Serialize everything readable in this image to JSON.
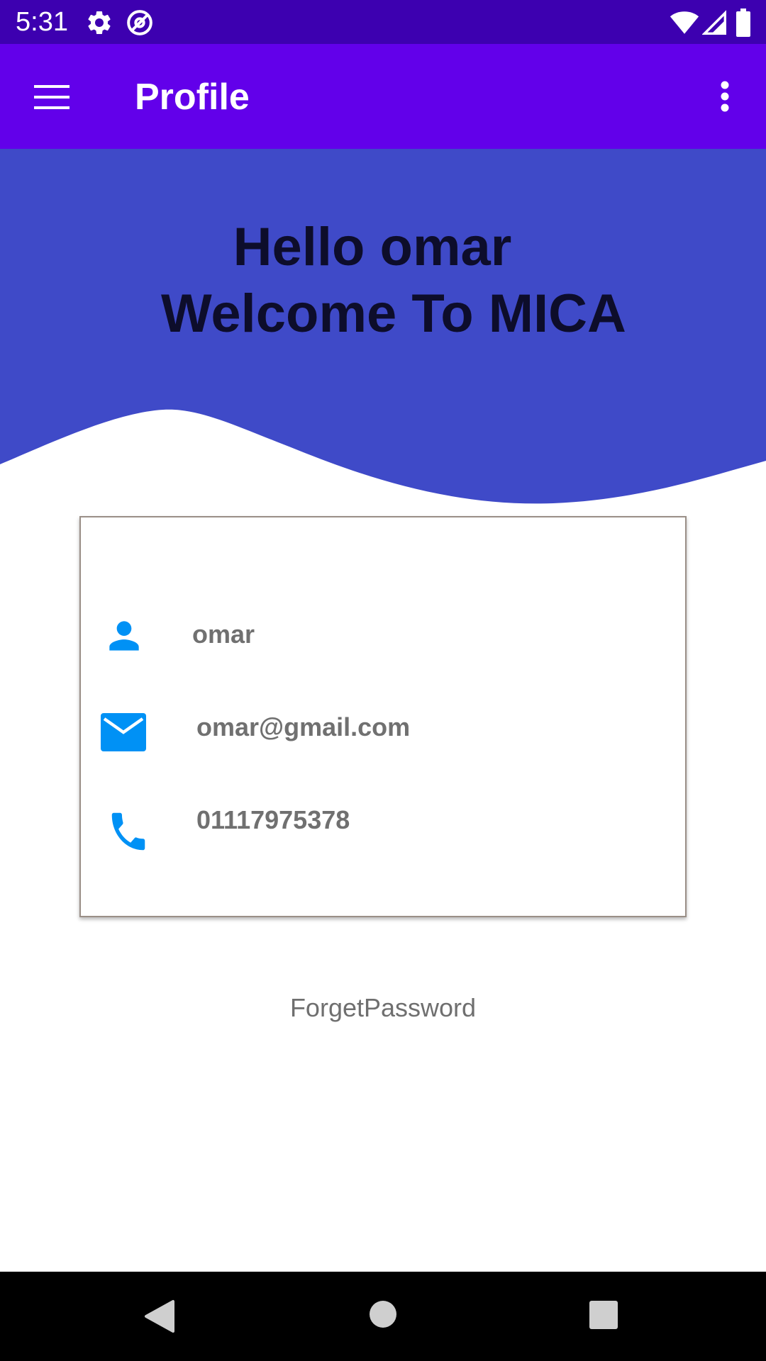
{
  "status_bar": {
    "time": "5:31",
    "icons": [
      "gear-icon",
      "at-sign-icon",
      "wifi-icon",
      "signal-icon",
      "battery-icon"
    ]
  },
  "app_bar": {
    "title": "Profile",
    "menu_icon": "hamburger-menu-icon",
    "overflow_icon": "more-vertical-icon",
    "background": "#6200ea"
  },
  "hero": {
    "greeting": "Hello omar",
    "welcome": "Welcome To MICA",
    "background": "#3f4ac8"
  },
  "profile_card": {
    "name": "omar",
    "email": "omar@gmail.com",
    "phone": "01117975378",
    "icon_color": "#0091f5",
    "icons": [
      "person-icon",
      "email-icon",
      "phone-icon"
    ]
  },
  "forget_password_label": "ForgetPassword",
  "nav_bar": {
    "icons": [
      "back-icon",
      "home-icon",
      "recents-icon"
    ]
  }
}
